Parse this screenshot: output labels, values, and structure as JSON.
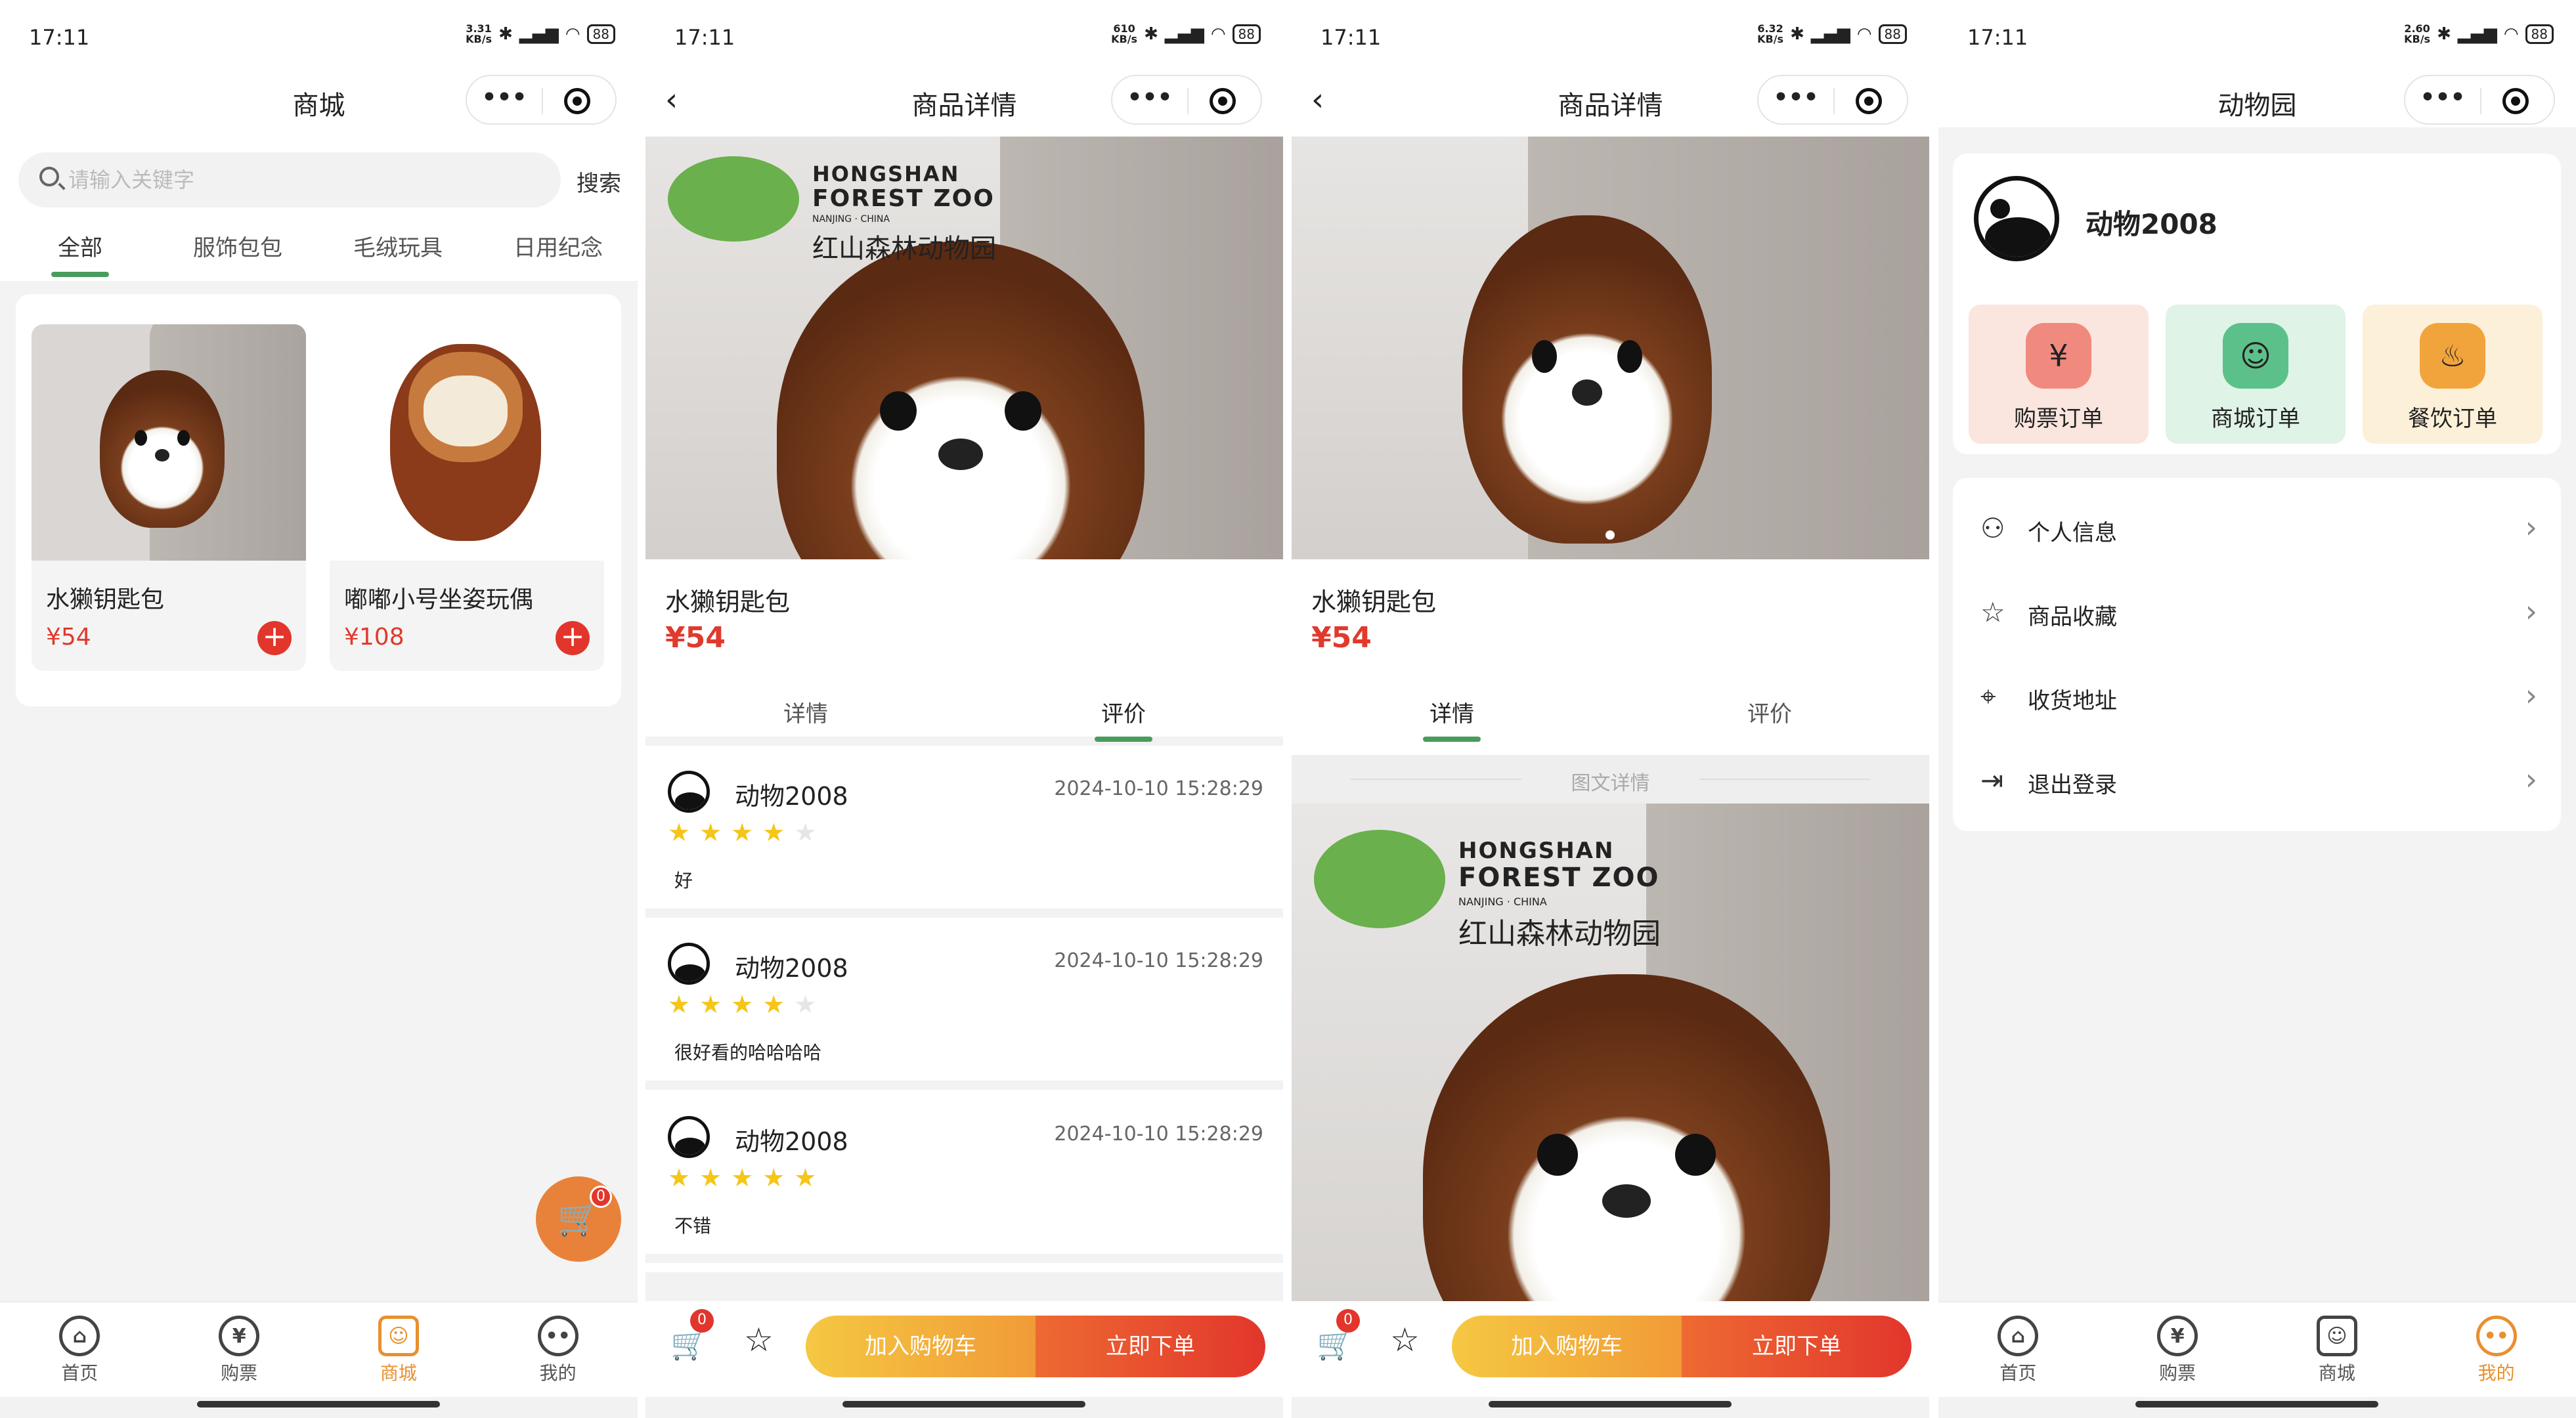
{
  "status": {
    "time": "17:11",
    "battery": "88",
    "speeds": [
      "3.31\nKB/s",
      "610\nKB/s",
      "6.32\nKB/s",
      "2.60\nKB/s"
    ]
  },
  "screen1": {
    "title": "商城",
    "search_placeholder": "请输入关键字",
    "search_button": "搜索",
    "categories": [
      "全部",
      "服饰包包",
      "毛绒玩具",
      "日用纪念"
    ],
    "products": [
      {
        "name": "水獭钥匙包",
        "price": "¥54"
      },
      {
        "name": "嘟嘟小号坐姿玩偶",
        "price": "¥108"
      }
    ],
    "cart_count": "0"
  },
  "detail": {
    "title": "商品详情",
    "name": "水獭钥匙包",
    "price": "¥54",
    "tabs": [
      "详情",
      "评价"
    ],
    "logo": {
      "line1": "HONGSHAN",
      "line2": "FOREST ZOO",
      "line3": "NANJING · CHINA",
      "line4": "红山森林动物园"
    },
    "reviews": [
      {
        "user": "动物2008",
        "time": "2024-10-10 15:28:29",
        "stars": 4,
        "text": "好"
      },
      {
        "user": "动物2008",
        "time": "2024-10-10 15:28:29",
        "stars": 4,
        "text": "很好看的哈哈哈哈"
      },
      {
        "user": "动物2008",
        "time": "2024-10-10 15:28:29",
        "stars": 5,
        "text": "不错"
      }
    ],
    "gallery_title": "图文详情",
    "cart_count": "0",
    "add_cart": "加入购物车",
    "buy_now": "立即下单"
  },
  "profile": {
    "title": "动物园",
    "username": "动物2008",
    "orders": [
      "购票订单",
      "商城订单",
      "餐饮订单"
    ],
    "menu": [
      "个人信息",
      "商品收藏",
      "收货地址",
      "退出登录"
    ]
  },
  "tabbar": [
    "首页",
    "购票",
    "商城",
    "我的"
  ],
  "colors": {
    "accent_green": "#4a9c5e",
    "price_red": "#e03a2d",
    "tab_active": "#e8902f",
    "order_pink": "#fae6df",
    "order_green": "#dff3e6",
    "order_yellow": "#fcf0d8"
  }
}
